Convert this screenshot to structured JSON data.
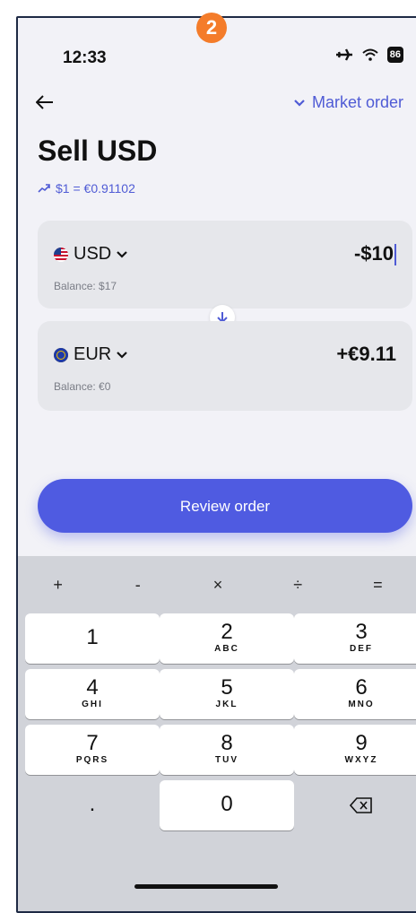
{
  "step_badge": "2",
  "status": {
    "time": "12:33",
    "battery": "86"
  },
  "header": {
    "back_icon": "arrow-left-icon",
    "order_type": "Market order"
  },
  "title": "Sell USD",
  "rate": "$1 = €0.91102",
  "from": {
    "currency": "USD",
    "balance": "Balance: $17",
    "amount": "-$10"
  },
  "to": {
    "currency": "EUR",
    "balance": "Balance: €0",
    "amount": "+€9.11"
  },
  "review_button": "Review order",
  "keyboard": {
    "operators": [
      "+",
      "-",
      "×",
      "÷",
      "="
    ],
    "keys": [
      {
        "num": "1",
        "letters": ""
      },
      {
        "num": "2",
        "letters": "ABC"
      },
      {
        "num": "3",
        "letters": "DEF"
      },
      {
        "num": "4",
        "letters": "GHI"
      },
      {
        "num": "5",
        "letters": "JKL"
      },
      {
        "num": "6",
        "letters": "MNO"
      },
      {
        "num": "7",
        "letters": "PQRS"
      },
      {
        "num": "8",
        "letters": "TUV"
      },
      {
        "num": "9",
        "letters": "WXYZ"
      }
    ],
    "dot": ".",
    "zero": "0"
  },
  "colors": {
    "accent": "#4f5be1",
    "badge": "#f47c2a",
    "card": "#e6e7eb",
    "keyboard": "#d1d3d9"
  }
}
